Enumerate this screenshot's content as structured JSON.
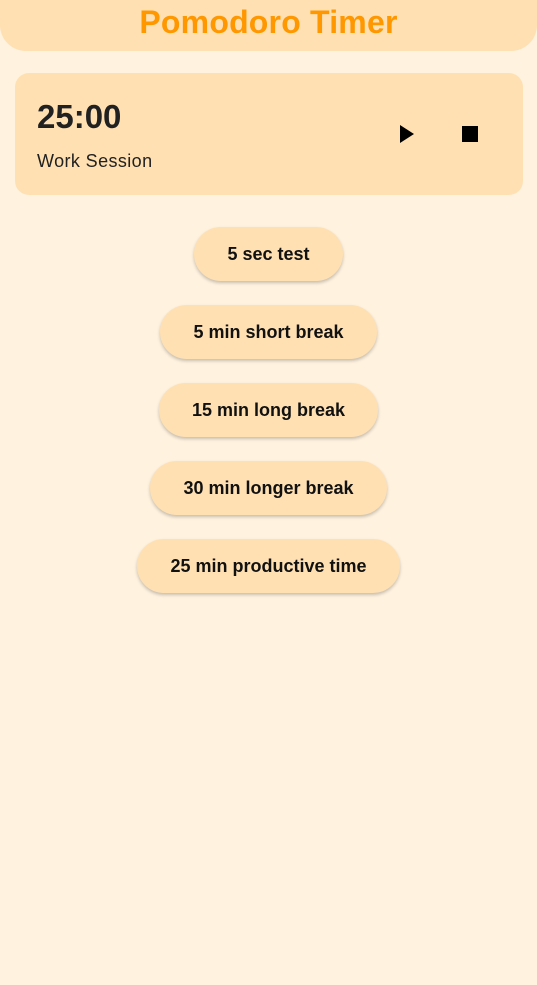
{
  "app": {
    "title": "Pomodoro Timer"
  },
  "timer": {
    "time": "25:00",
    "session": "Work Session",
    "controls": {
      "play_icon": "play-icon",
      "stop_icon": "stop-icon"
    }
  },
  "presets": [
    {
      "label": "5 sec test"
    },
    {
      "label": "5 min short break"
    },
    {
      "label": "15 min long break"
    },
    {
      "label": "30 min longer break"
    },
    {
      "label": "25 min productive time"
    }
  ],
  "colors": {
    "background": "#FFF2DF",
    "surface": "#FFE0B2",
    "accent": "#FF9800",
    "text": "#212121"
  }
}
